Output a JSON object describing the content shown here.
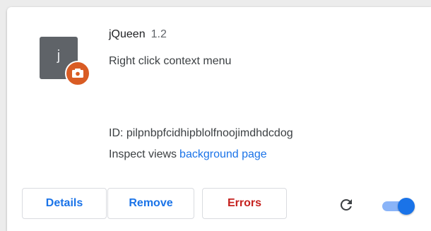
{
  "extension": {
    "icon_letter": "j",
    "icon_name": "extension-j-icon",
    "badge_icon": "unpacked-badge-icon",
    "name": "jQueen",
    "version": "1.2",
    "description": "Right click context menu",
    "id_text": "ID: pilpnbpfcidhipblolfnoojimdhdcdog",
    "inspect_label": "Inspect views",
    "inspect_link": "background page"
  },
  "actions": {
    "details_label": "Details",
    "remove_label": "Remove",
    "errors_label": "Errors",
    "reload_icon": "reload-icon",
    "enabled": true
  },
  "colors": {
    "link_blue": "#1a73e8",
    "error_red": "#c5221f",
    "icon_gray": "#5f6368",
    "badge_orange": "#d95c24",
    "toggle_track": "#8ab4f8"
  }
}
